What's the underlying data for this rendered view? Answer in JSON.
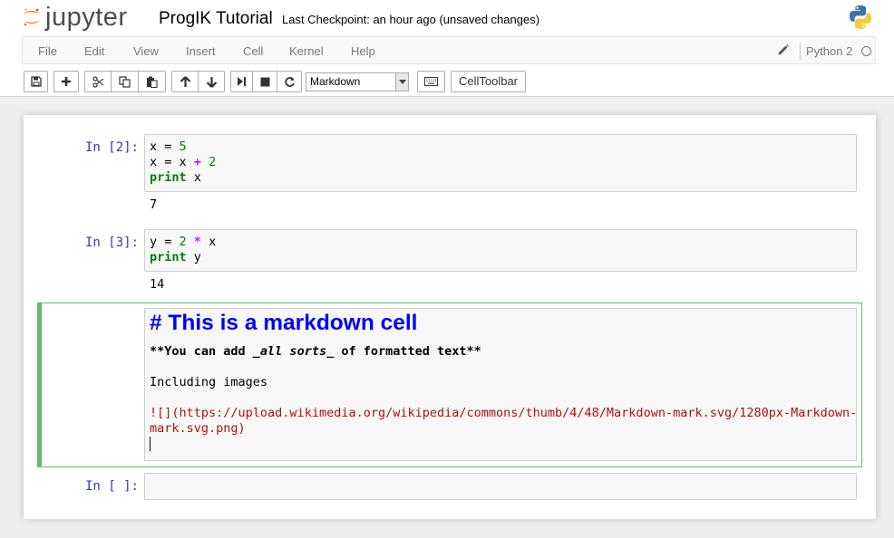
{
  "header": {
    "logo_text": "jupyter",
    "notebook_name": "ProgIK Tutorial",
    "checkpoint": "Last Checkpoint: an hour ago (unsaved changes)"
  },
  "menubar": {
    "items": [
      "File",
      "Edit",
      "View",
      "Insert",
      "Cell",
      "Kernel",
      "Help"
    ],
    "kernel_name": "Python 2"
  },
  "toolbar": {
    "cell_type": "Markdown",
    "celltoolbar_label": "CellToolbar"
  },
  "cells": [
    {
      "prompt": "In [2]:",
      "output": "7"
    },
    {
      "prompt": "In [3]:",
      "output": "14"
    },
    {
      "type": "markdown",
      "heading": "# This is a markdown cell",
      "bold_pre": "**You can add ",
      "bold_em": "_all sorts_",
      "bold_post": " of formatted text**",
      "plain": "Including images",
      "link_bang": "![]",
      "link_line1": "(https://upload.wikimedia.org/wikipedia/commons/thumb/4/48/Markdown-mark.svg/1280px-Markdown-",
      "link_line2": "mark.svg.png)"
    },
    {
      "prompt": "In [ ]:"
    }
  ],
  "code": {
    "cell1": {
      "l1_a": "x = ",
      "l1_n": "5",
      "l2_a": "x = x ",
      "l2_op": "+",
      "l2_b": " ",
      "l2_n": "2",
      "l3_kw": "print",
      "l3_b": " x"
    },
    "cell2": {
      "l1_a": "y = ",
      "l1_n": "2",
      "l1_b": " ",
      "l1_op": "*",
      "l1_c": " x",
      "l2_kw": "print",
      "l2_b": " y"
    }
  },
  "colors": {
    "prompt": "#303f9f",
    "keyword": "#008000",
    "operator": "#aa22ff",
    "md_heading": "#0000ff",
    "md_link": "#aa1111",
    "edit_border": "#66bb6a",
    "logo_orange": "#f37726"
  },
  "icons": [
    "save-icon",
    "plus-icon",
    "cut-icon",
    "copy-icon",
    "paste-icon",
    "arrow-up-icon",
    "arrow-down-icon",
    "step-forward-icon",
    "stop-icon",
    "refresh-icon",
    "keyboard-icon",
    "pencil-icon",
    "python-logo-icon",
    "kernel-idle-icon"
  ]
}
